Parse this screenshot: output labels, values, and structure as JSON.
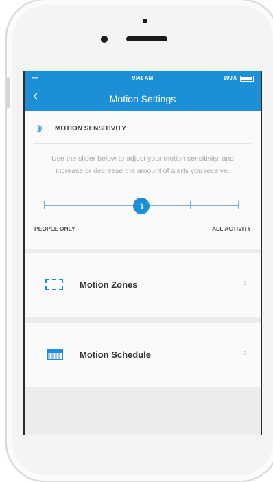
{
  "status_bar": {
    "signal": "•••••",
    "time": "9:41 AM",
    "battery": "100%"
  },
  "nav": {
    "back_icon": "chevron-left-icon",
    "back_glyph": "‹",
    "title": "Motion Settings"
  },
  "sensitivity": {
    "icon_glyph": "))))",
    "heading": "MOTION SENSITIVITY",
    "description": "Use the slider below to adjust your motion sensitivity, and increase or decrease the amount of alerts you receive.",
    "slider_value_percent": 50,
    "thumb_glyph": "))",
    "label_left": "PEOPLE ONLY",
    "label_right": "ALL ACTIVITY"
  },
  "rows": [
    {
      "label": "Motion Zones",
      "icon": "motion-zones-icon",
      "chevron": "›"
    },
    {
      "label": "Motion Schedule",
      "icon": "calendar-icon",
      "chevron": "›"
    }
  ],
  "colors": {
    "accent": "#1d8fd6",
    "background": "#ececec",
    "card": "#fafafa"
  }
}
